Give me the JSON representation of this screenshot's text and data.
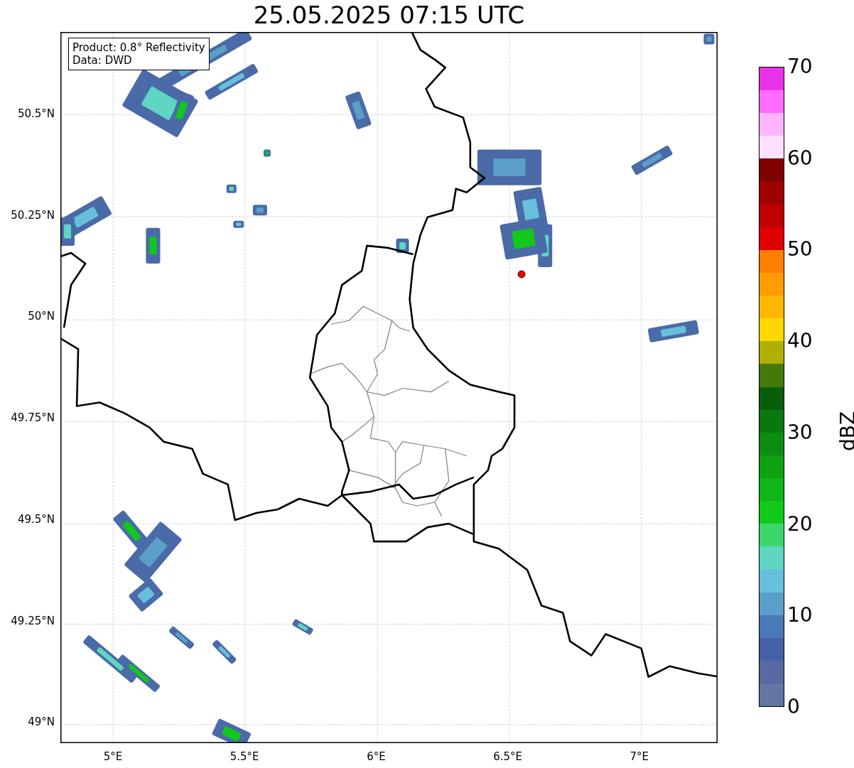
{
  "title": "25.05.2025 07:15 UTC",
  "info_box": {
    "lines": [
      "Product: 0.8° Reflectivity",
      "Data: DWD"
    ]
  },
  "map": {
    "lat_ticks": [
      "50.5°N",
      "50.25°N",
      "50°N",
      "49.75°N",
      "49.5°N",
      "49.25°N",
      "49°N"
    ],
    "lon_ticks": [
      "5°E",
      "5.5°E",
      "6°E",
      "6.5°E",
      "7°E"
    ]
  },
  "colorbar": {
    "label": "dBZ",
    "ticks": [
      "70",
      "60",
      "50",
      "40",
      "30",
      "20",
      "10",
      "0"
    ],
    "bins": [
      {
        "color": "#e832e8"
      },
      {
        "color": "#ff6cff"
      },
      {
        "color": "#ffb4ff"
      },
      {
        "color": "#ffe0ff"
      },
      {
        "color": "#800000"
      },
      {
        "color": "#a00000"
      },
      {
        "color": "#c00000"
      },
      {
        "color": "#e00000"
      },
      {
        "color": "#ff7e00"
      },
      {
        "color": "#ff9c00"
      },
      {
        "color": "#ffb800"
      },
      {
        "color": "#ffd800"
      },
      {
        "color": "#b0b000"
      },
      {
        "color": "#457a0a"
      },
      {
        "color": "#085e0a"
      },
      {
        "color": "#0a780e"
      },
      {
        "color": "#0c8c10"
      },
      {
        "color": "#0ea212"
      },
      {
        "color": "#10b518"
      },
      {
        "color": "#12c81a"
      },
      {
        "color": "#3cd66c"
      },
      {
        "color": "#5fd6c1"
      },
      {
        "color": "#66c0dc"
      },
      {
        "color": "#5b9ec8"
      },
      {
        "color": "#4a7ab5"
      },
      {
        "color": "#4660a4"
      },
      {
        "color": "#5868a0"
      },
      {
        "color": "#6475a4"
      }
    ]
  }
}
